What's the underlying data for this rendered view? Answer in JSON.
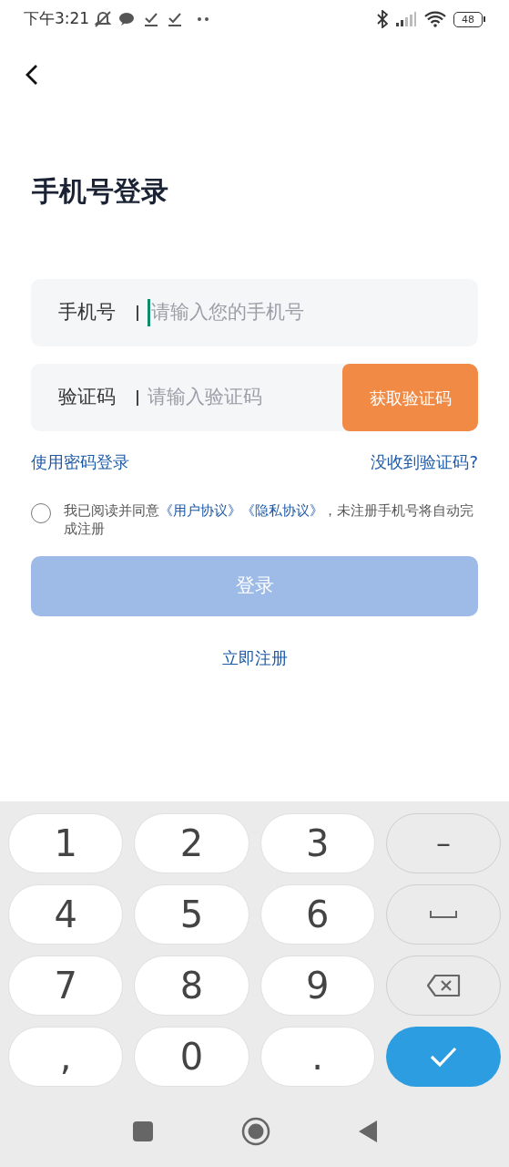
{
  "status_bar": {
    "time": "下午3:21",
    "battery": "48"
  },
  "title": "手机号登录",
  "phone_field": {
    "label": "手机号",
    "placeholder": "请输入您的手机号",
    "focused": true
  },
  "code_field": {
    "label": "验证码",
    "placeholder": "请输入验证码",
    "button": "获取验证码"
  },
  "links": {
    "password_login": "使用密码登录",
    "no_code": "没收到验证码?"
  },
  "agreement": {
    "checked": false,
    "prefix": "我已阅读并同意",
    "links": [
      "《用户协议》",
      "《隐私协议》"
    ],
    "suffix": "，未注册手机号将自动完成注册"
  },
  "login_button": {
    "label": "登录",
    "disabled": true
  },
  "register_link": "立即注册",
  "keyboard": {
    "keys": [
      {
        "kind": "char",
        "label": "1"
      },
      {
        "kind": "char",
        "label": "2"
      },
      {
        "kind": "char",
        "label": "3"
      },
      {
        "kind": "side",
        "label": "–"
      },
      {
        "kind": "char",
        "label": "4"
      },
      {
        "kind": "char",
        "label": "5"
      },
      {
        "kind": "char",
        "label": "6"
      },
      {
        "kind": "space"
      },
      {
        "kind": "char",
        "label": "7"
      },
      {
        "kind": "char",
        "label": "8"
      },
      {
        "kind": "char",
        "label": "9"
      },
      {
        "kind": "backspace"
      },
      {
        "kind": "char",
        "label": ","
      },
      {
        "kind": "char",
        "label": "0"
      },
      {
        "kind": "char",
        "label": "."
      },
      {
        "kind": "enter"
      }
    ]
  }
}
